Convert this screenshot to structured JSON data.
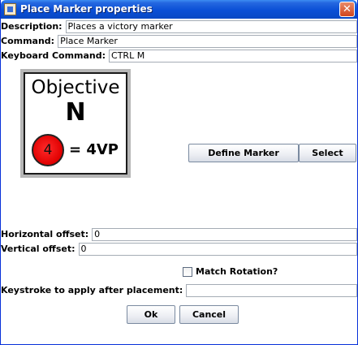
{
  "window": {
    "title": "Place Marker properties",
    "close_glyph": "✕"
  },
  "form": {
    "description_label": "Description:",
    "description_value": "Places a victory marker",
    "command_label": "Command:",
    "command_value": "Place Marker",
    "keyboard_label": "Keyboard Command:",
    "keyboard_value": "CTRL M",
    "horizontal_label": "Horizontal offset:",
    "horizontal_value": "0",
    "vertical_label": "Vertical offset:",
    "vertical_value": "0",
    "match_rotation_label": "Match Rotation?",
    "match_rotation_checked": false,
    "keystroke_label": "Keystroke to apply after placement:",
    "keystroke_value": ""
  },
  "marker": {
    "heading": "Objective",
    "letter": "N",
    "circle_number": "4",
    "vp_text": "= 4VP"
  },
  "buttons": {
    "define_marker": "Define Marker",
    "select": "Select",
    "ok": "Ok",
    "cancel": "Cancel"
  },
  "colors": {
    "titlebar": "#0a4fd6",
    "close": "#d2461e",
    "marker_circle": "#e00000"
  }
}
